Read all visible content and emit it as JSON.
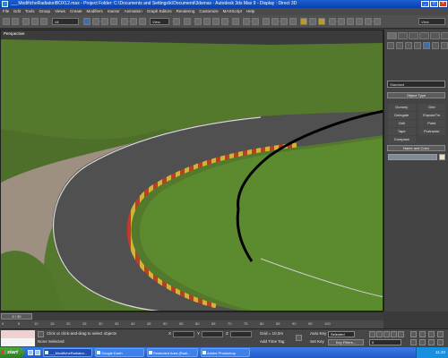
{
  "window": {
    "title": "___ModificheRadiatoriBOX12.max   -   Project Folder: C:\\Documents and Settings\\k\\Documenti\\3dsmax   -   Autodesk 3ds Max 9   -   Display : Direct 3D",
    "minimize": "_",
    "maximize": "□",
    "close": "×"
  },
  "menu": [
    "File",
    "Edit",
    "Tools",
    "Group",
    "Views",
    "Create",
    "Modifiers",
    "reactor",
    "Animation",
    "Graph Editors",
    "Rendering",
    "Customize",
    "MAXScript",
    "Help"
  ],
  "toolbar": {
    "selection_filter": "All",
    "reference_coord": "View",
    "named_selection": "View"
  },
  "viewport": {
    "label": "Perspective"
  },
  "command_panel": {
    "category": "Standard",
    "object_type_header": "Object Type",
    "object_types": [
      "Dummy",
      "Grid",
      "Delegate",
      "ExposeTm",
      "Grill",
      "Point",
      "Tape",
      "Protractor",
      "Compass"
    ],
    "name_color_header": "Name and Color"
  },
  "timeline": {
    "frame_display": "0 / 30",
    "ticks": [
      "0",
      "5",
      "10",
      "15",
      "20",
      "25",
      "30",
      "35",
      "40",
      "45",
      "50",
      "55",
      "60",
      "65",
      "70",
      "75",
      "80",
      "85",
      "90",
      "95",
      "100"
    ]
  },
  "status": {
    "selection": "None Selected",
    "prompt": "Click or click-and-drag to select objects",
    "x_label": "X",
    "y_label": "Y",
    "z_label": "Z",
    "grid": "Grid = 10,0m",
    "add_time_tag": "Add Time Tag",
    "auto_key": "Auto Key",
    "auto_key_value": "Selected",
    "set_key": "Set Key",
    "key_filters": "Key Filters...",
    "frame_value": "0"
  },
  "taskbar": {
    "start_label": "start",
    "tasks": [
      "___ModificheRadiator...",
      "Google Earth",
      "Restricted Area (Radi...",
      "Adobe Photoshop"
    ],
    "clock": "11:40"
  },
  "colors": {
    "title_bar": "#1a5fd0",
    "taskbar": "#2a62d8",
    "start_button": "#3a9a2e",
    "grass": "#4f7a26",
    "asphalt": "#555"
  }
}
